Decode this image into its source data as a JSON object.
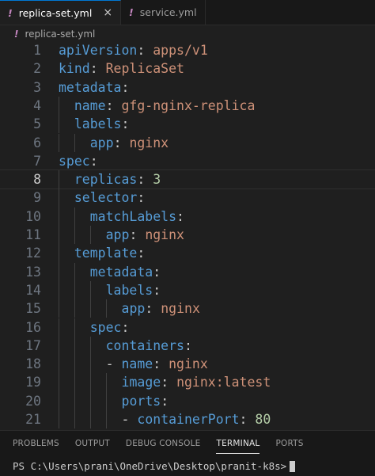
{
  "tabs": [
    {
      "icon": "!",
      "label": "replica-set.yml",
      "close": "×",
      "active": true
    },
    {
      "icon": "!",
      "label": "service.yml",
      "active": false
    }
  ],
  "breadcrumb": {
    "icon": "!",
    "file": "replica-set.yml"
  },
  "editor": {
    "current_line": 8,
    "lines": [
      {
        "num": "1",
        "indent": 0,
        "tokens": [
          [
            "k",
            "apiVersion"
          ],
          [
            "p",
            ": "
          ],
          [
            "v",
            "apps/v1"
          ]
        ]
      },
      {
        "num": "2",
        "indent": 0,
        "tokens": [
          [
            "k",
            "kind"
          ],
          [
            "p",
            ": "
          ],
          [
            "v",
            "ReplicaSet"
          ]
        ]
      },
      {
        "num": "3",
        "indent": 0,
        "tokens": [
          [
            "k",
            "metadata"
          ],
          [
            "p",
            ":"
          ]
        ]
      },
      {
        "num": "4",
        "indent": 1,
        "tokens": [
          [
            "k",
            "name"
          ],
          [
            "p",
            ": "
          ],
          [
            "v",
            "gfg-nginx-replica"
          ]
        ]
      },
      {
        "num": "5",
        "indent": 1,
        "tokens": [
          [
            "k",
            "labels"
          ],
          [
            "p",
            ":"
          ]
        ]
      },
      {
        "num": "6",
        "indent": 2,
        "tokens": [
          [
            "k",
            "app"
          ],
          [
            "p",
            ": "
          ],
          [
            "v",
            "nginx"
          ]
        ]
      },
      {
        "num": "7",
        "indent": 0,
        "tokens": [
          [
            "k",
            "spec"
          ],
          [
            "p",
            ":"
          ]
        ]
      },
      {
        "num": "8",
        "indent": 1,
        "tokens": [
          [
            "k",
            "replicas"
          ],
          [
            "p",
            ": "
          ],
          [
            "n",
            "3"
          ]
        ]
      },
      {
        "num": "9",
        "indent": 1,
        "tokens": [
          [
            "k",
            "selector"
          ],
          [
            "p",
            ":"
          ]
        ]
      },
      {
        "num": "10",
        "indent": 2,
        "tokens": [
          [
            "k",
            "matchLabels"
          ],
          [
            "p",
            ":"
          ]
        ]
      },
      {
        "num": "11",
        "indent": 3,
        "tokens": [
          [
            "k",
            "app"
          ],
          [
            "p",
            ": "
          ],
          [
            "v",
            "nginx"
          ]
        ]
      },
      {
        "num": "12",
        "indent": 1,
        "tokens": [
          [
            "k",
            "template"
          ],
          [
            "p",
            ":"
          ]
        ]
      },
      {
        "num": "13",
        "indent": 2,
        "tokens": [
          [
            "k",
            "metadata"
          ],
          [
            "p",
            ":"
          ]
        ]
      },
      {
        "num": "14",
        "indent": 3,
        "tokens": [
          [
            "k",
            "labels"
          ],
          [
            "p",
            ":"
          ]
        ]
      },
      {
        "num": "15",
        "indent": 4,
        "tokens": [
          [
            "k",
            "app"
          ],
          [
            "p",
            ": "
          ],
          [
            "v",
            "nginx"
          ]
        ]
      },
      {
        "num": "16",
        "indent": 2,
        "tokens": [
          [
            "k",
            "spec"
          ],
          [
            "p",
            ":"
          ]
        ]
      },
      {
        "num": "17",
        "indent": 3,
        "tokens": [
          [
            "k",
            "containers"
          ],
          [
            "p",
            ":"
          ]
        ]
      },
      {
        "num": "18",
        "indent": 3,
        "tokens": [
          [
            "p",
            "- "
          ],
          [
            "k",
            "name"
          ],
          [
            "p",
            ": "
          ],
          [
            "v",
            "nginx"
          ]
        ]
      },
      {
        "num": "19",
        "indent": 4,
        "tokens": [
          [
            "k",
            "image"
          ],
          [
            "p",
            ": "
          ],
          [
            "v",
            "nginx:latest"
          ]
        ]
      },
      {
        "num": "20",
        "indent": 4,
        "tokens": [
          [
            "k",
            "ports"
          ],
          [
            "p",
            ":"
          ]
        ]
      },
      {
        "num": "21",
        "indent": 4,
        "tokens": [
          [
            "p",
            "- "
          ],
          [
            "k",
            "containerPort"
          ],
          [
            "p",
            ": "
          ],
          [
            "n",
            "80"
          ]
        ]
      }
    ]
  },
  "panel": {
    "tabs": [
      {
        "label": "PROBLEMS",
        "active": false
      },
      {
        "label": "OUTPUT",
        "active": false
      },
      {
        "label": "DEBUG CONSOLE",
        "active": false
      },
      {
        "label": "TERMINAL",
        "active": true
      },
      {
        "label": "PORTS",
        "active": false
      }
    ]
  },
  "terminal": {
    "prompt": "PS C:\\Users\\prani\\OneDrive\\Desktop\\pranit-k8s>"
  },
  "colors": {
    "key": "#569cd6",
    "string": "#ce9178",
    "number": "#b5cea8",
    "yaml_icon": "#c586c0",
    "active_tab_border": "#0078d4"
  }
}
